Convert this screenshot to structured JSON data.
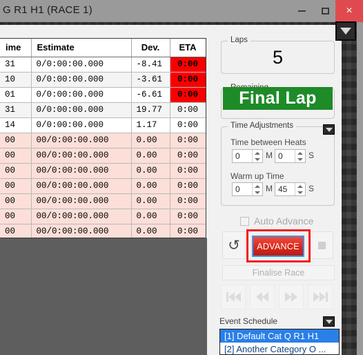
{
  "window": {
    "title": "G R1 H1 (RACE 1)",
    "minimize_label": "minimize",
    "maximize_label": "maximize",
    "close_label": "×"
  },
  "grid": {
    "columns": [
      "ime",
      "Estimate",
      "Dev.",
      "ETA"
    ],
    "rows": [
      {
        "time": "31",
        "estimate": "0/0:00:00.000",
        "dev": "-8.41",
        "eta": "0:00",
        "style": "white",
        "eta_alert": true
      },
      {
        "time": "10",
        "estimate": "0/0:00:00.000",
        "dev": "-3.61",
        "eta": "0:00",
        "style": "alt",
        "eta_alert": true
      },
      {
        "time": "01",
        "estimate": "0/0:00:00.000",
        "dev": "-6.61",
        "eta": "0:00",
        "style": "white",
        "eta_alert": true
      },
      {
        "time": "31",
        "estimate": "0/0:00:00.000",
        "dev": "19.77",
        "eta": "0:00",
        "style": "alt",
        "eta_alert": false
      },
      {
        "time": "14",
        "estimate": "0/0:00:00.000",
        "dev": "1.17",
        "eta": "0:00",
        "style": "white",
        "eta_alert": false
      },
      {
        "time": "00",
        "estimate": "00/0:00:00.000",
        "dev": "0.00",
        "eta": "0:00",
        "style": "pink",
        "eta_alert": false
      },
      {
        "time": "00",
        "estimate": "00/0:00:00.000",
        "dev": "0.00",
        "eta": "0:00",
        "style": "pink",
        "eta_alert": false
      },
      {
        "time": "00",
        "estimate": "00/0:00:00.000",
        "dev": "0.00",
        "eta": "0:00",
        "style": "pink",
        "eta_alert": false
      },
      {
        "time": "00",
        "estimate": "00/0:00:00.000",
        "dev": "0.00",
        "eta": "0:00",
        "style": "pink",
        "eta_alert": false
      },
      {
        "time": "00",
        "estimate": "00/0:00:00.000",
        "dev": "0.00",
        "eta": "0:00",
        "style": "pink",
        "eta_alert": false
      },
      {
        "time": "00",
        "estimate": "00/0:00:00.000",
        "dev": "0.00",
        "eta": "0:00",
        "style": "pink",
        "eta_alert": false
      },
      {
        "time": "00",
        "estimate": "00/0:00:00.000",
        "dev": "0.00",
        "eta": "0:00",
        "style": "pink",
        "eta_alert": false
      }
    ]
  },
  "laps": {
    "legend": "Laps",
    "value": "5"
  },
  "remaining": {
    "legend": "Remaining",
    "value": "Final Lap",
    "color": "#1d8b27"
  },
  "time_adjustments": {
    "legend": "Time Adjustments",
    "between_heats_label": "Time between Heats",
    "between_heats_minutes": "0",
    "between_heats_seconds": "0",
    "warmup_label": "Warm up Time",
    "warmup_minutes": "0",
    "warmup_seconds": "45",
    "minutes_unit": "M",
    "seconds_unit": "S"
  },
  "auto_advance": {
    "label": "Auto Advance",
    "checked": false
  },
  "actions": {
    "undo_label": "↺",
    "advance_label": "ADVANCE",
    "advance_highlight_color": "#f41a1a",
    "finalise_label": "Finalise Race"
  },
  "transport": {
    "first_label": "skip-to-start",
    "rewind_label": "rewind",
    "forward_label": "fast-forward",
    "last_label": "skip-to-end"
  },
  "event_schedule": {
    "label": "Event Schedule",
    "items": [
      {
        "text": "[1] Default Cat Q R1 H1",
        "selected": true
      },
      {
        "text": "[2] Another Category O ...",
        "selected": false
      }
    ]
  }
}
